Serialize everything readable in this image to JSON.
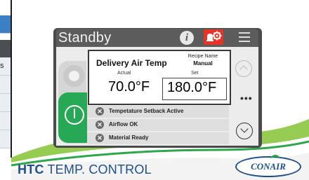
{
  "edge": {
    "row_text": "s"
  },
  "device": {
    "status_title": "Standby",
    "readout": {
      "label": "Delivery Air Temp",
      "recipe_caption": "Recipe Name",
      "recipe_value": "Manual",
      "actual_caption": "Actual",
      "actual_value": "70.0°F",
      "set_caption": "Set",
      "set_value": "180.0°F"
    },
    "more_label": "•••",
    "status_items": [
      {
        "icon": "x-circle-icon",
        "text": "Tempetature Setback Active"
      },
      {
        "icon": "x-circle-icon",
        "text": "Airflow OK"
      },
      {
        "icon": "x-circle-icon",
        "text": "Material Ready"
      }
    ]
  },
  "footer": {
    "product_bold": "HTC",
    "product_rest": " TEMP. CONTROL",
    "logo_text": "CONAIR"
  },
  "colors": {
    "brand_blue": "#1d4f8a",
    "accent_green": "#27a854",
    "alarm_red": "#e53328",
    "panel_dark": "#4a4a4a"
  }
}
